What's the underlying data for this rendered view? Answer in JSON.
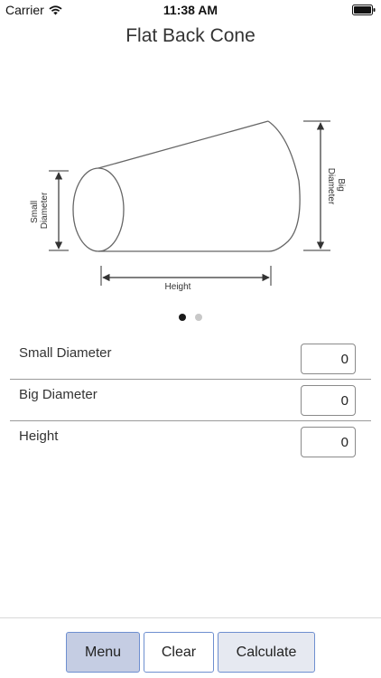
{
  "status_bar": {
    "carrier": "Carrier",
    "time": "11:38 AM"
  },
  "title": "Flat Back Cone",
  "diagram": {
    "small_diameter_label": [
      "Small",
      "Diameter"
    ],
    "big_diameter_label": [
      "Big",
      "Diameter"
    ],
    "height_label": "Height"
  },
  "pagination": {
    "page_count": 2,
    "current_page": 1
  },
  "fields": [
    {
      "label": "Small Diameter",
      "value": "0"
    },
    {
      "label": "Big Diameter",
      "value": "0"
    },
    {
      "label": "Height",
      "value": "0"
    }
  ],
  "toolbar": {
    "menu_label": "Menu",
    "clear_label": "Clear",
    "calculate_label": "Calculate"
  },
  "colors": {
    "button_border": "#6e8fd0",
    "menu_bg": "#c5cde3",
    "calculate_bg": "#e6e9f1"
  }
}
